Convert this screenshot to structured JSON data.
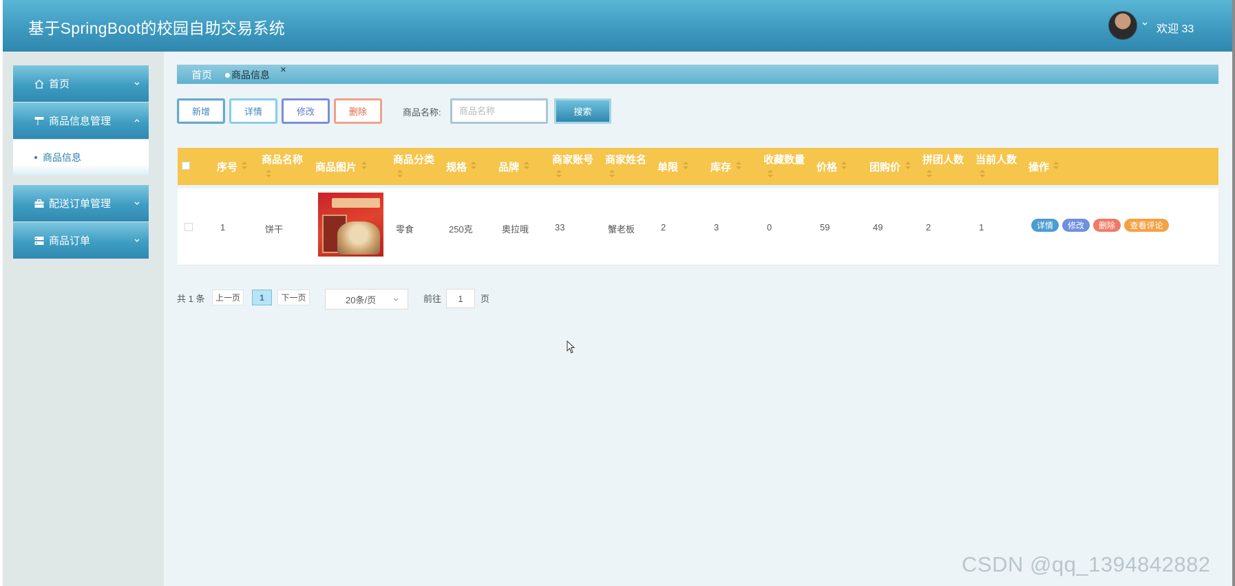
{
  "header": {
    "title": "基于SpringBoot的校园自助交易系统",
    "welcome": "欢迎 33"
  },
  "sidebar": {
    "items": [
      {
        "label": "首页",
        "icon": "home-icon"
      },
      {
        "label": "商品信息管理",
        "icon": "table-icon",
        "expanded": true,
        "children": [
          {
            "label": "商品信息"
          }
        ]
      },
      {
        "label": "配送订单管理",
        "icon": "briefcase-icon"
      },
      {
        "label": "商品订单",
        "icon": "server-icon"
      }
    ]
  },
  "tabs": {
    "home": "首页",
    "active": "商品信息",
    "close": "×"
  },
  "toolbar": {
    "add": "新增",
    "detail": "详情",
    "edit": "修改",
    "delete": "删除",
    "search_label": "商品名称:",
    "search_placeholder": "商品名称",
    "search_button": "搜索"
  },
  "table": {
    "columns": [
      "序号",
      "商品名称",
      "商品图片",
      "商品分类",
      "规格",
      "品牌",
      "商家账号",
      "商家姓名",
      "单限",
      "库存",
      "收藏数量",
      "价格",
      "团购价",
      "拼团人数",
      "当前人数",
      "操作"
    ],
    "rows": [
      {
        "index": "1",
        "name": "饼干",
        "category": "零食",
        "spec": "250克",
        "brand": "奥拉哦",
        "merchant_account": "33",
        "merchant_name": "蟹老板",
        "limit": "2",
        "stock": "3",
        "favorites": "0",
        "price": "59",
        "group_price": "49",
        "group_size": "2",
        "current_count": "1"
      }
    ],
    "row_actions": {
      "detail": "详情",
      "edit": "修改",
      "delete": "删除",
      "comments": "查看评论"
    }
  },
  "pagination": {
    "total": "共 1 条",
    "prev": "上一页",
    "current_page": "1",
    "next": "下一页",
    "page_size": "20条/页",
    "goto_label": "前往",
    "goto_value": "1",
    "page_suffix": "页"
  },
  "watermark": "CSDN @qq_1394842882",
  "colors": {
    "header": "#3f9ac0",
    "table_header": "#f5c54c",
    "accent": "#2f87ae"
  }
}
